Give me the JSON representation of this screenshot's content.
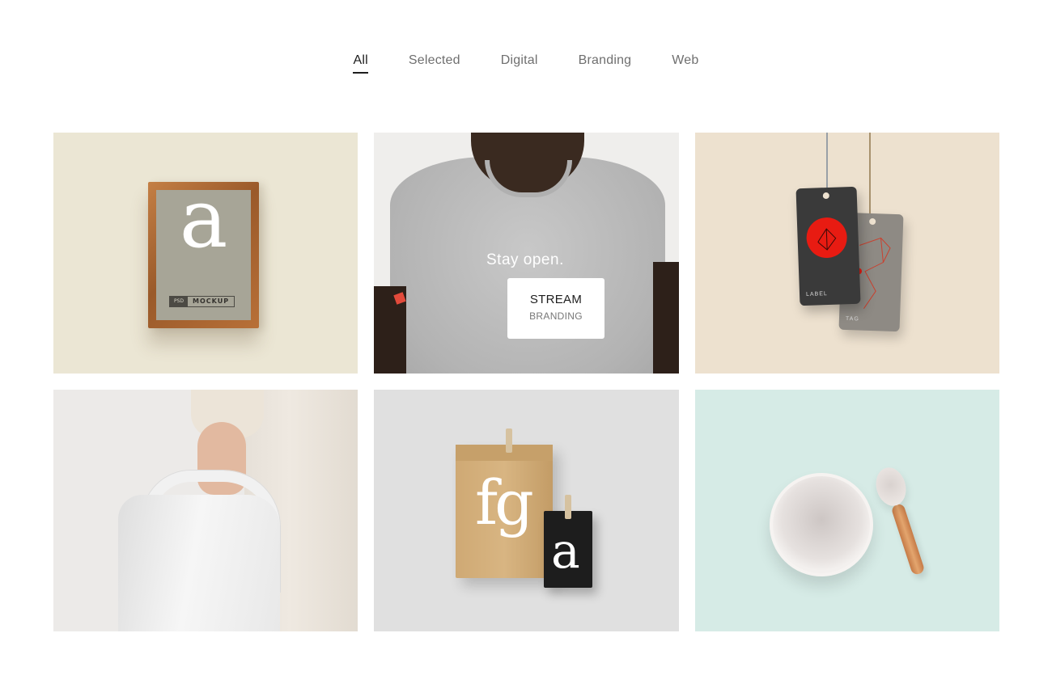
{
  "filters": {
    "all": "All",
    "selected": "Selected",
    "digital": "Digital",
    "branding": "Branding",
    "web": "Web"
  },
  "tiles": {
    "frame": {
      "letter": "a",
      "badge_psd": "PSD",
      "badge_mockup": "MOCKUP"
    },
    "tshirt": {
      "shirt_text": "Stay open.",
      "card_title": "STREAM",
      "card_category": "BRANDING"
    },
    "tags": {
      "label_dark": "LABEL",
      "label_grey": "TAG"
    },
    "bags": {
      "kraft_text": "fg",
      "black_text": "a"
    }
  },
  "colors": {
    "active_filter": "#1e1e1e",
    "inactive_filter": "#6f6f6f",
    "accent_red": "#e81b12"
  }
}
